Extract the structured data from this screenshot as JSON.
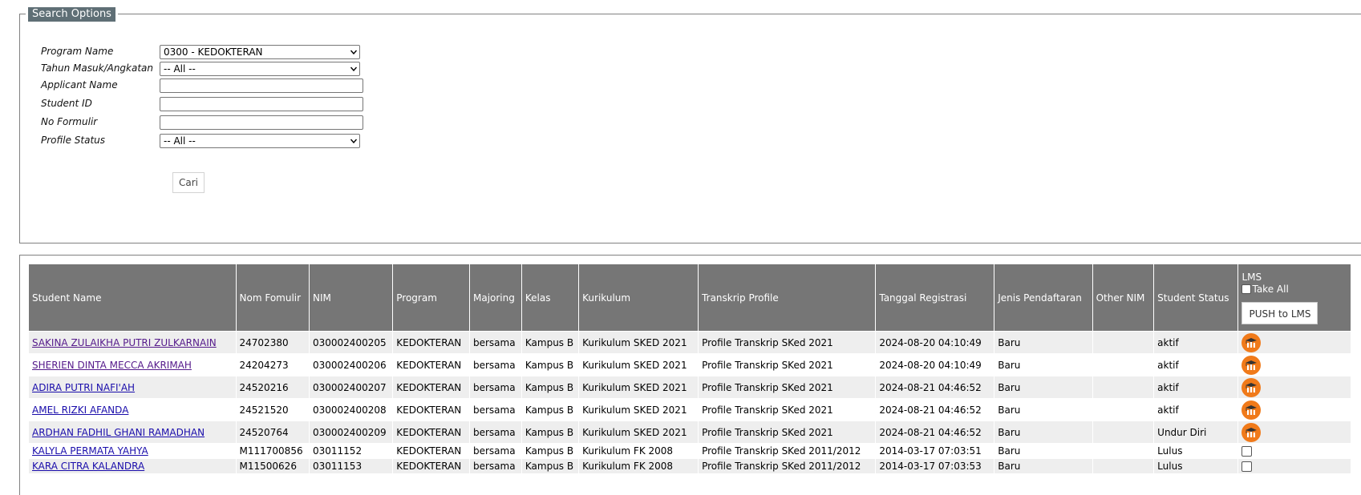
{
  "search": {
    "legend": "Search Options",
    "fields": [
      {
        "label": "Program Name",
        "type": "select",
        "value": "0300 - KEDOKTERAN"
      },
      {
        "label": "Tahun Masuk/Angkatan",
        "type": "select",
        "value": "-- All --"
      },
      {
        "label": "Applicant Name",
        "type": "text",
        "value": ""
      },
      {
        "label": "Student ID",
        "type": "text",
        "value": ""
      },
      {
        "label": "No Formulir",
        "type": "text",
        "value": ""
      },
      {
        "label": "Profile Status",
        "type": "select",
        "value": "-- All --"
      }
    ],
    "submit_label": "Cari"
  },
  "table": {
    "headers": [
      "Student Name",
      "Nom Fomulir",
      "NIM",
      "Program",
      "Majoring",
      "Kelas",
      "Kurikulum",
      "Transkrip Profile",
      "Tanggal Registrasi",
      "Jenis Pendaftaran",
      "Other NIM",
      "Student Status"
    ],
    "lms_header": {
      "label": "LMS",
      "take_all": "Take All",
      "push_button": "PUSH to LMS"
    },
    "rows": [
      {
        "name": "SAKINA ZULAIKHA PUTRI ZULKARNAIN",
        "formulir": "24702380",
        "nim": "030002400205",
        "program": "KEDOKTERAN",
        "majoring": "bersama",
        "kelas": "Kampus B",
        "kurikulum": "Kurikulum SKED 2021",
        "transkrip": "Profile Transkrip SKed 2021",
        "tanggal": "2024-08-20 04:10:49",
        "jenis": "Baru",
        "other_nim": "",
        "status": "aktif",
        "lms": "icon"
      },
      {
        "name": "SHERIEN DINTA MECCA AKRIMAH",
        "formulir": "24204273",
        "nim": "030002400206",
        "program": "KEDOKTERAN",
        "majoring": "bersama",
        "kelas": "Kampus B",
        "kurikulum": "Kurikulum SKED 2021",
        "transkrip": "Profile Transkrip SKed 2021",
        "tanggal": "2024-08-20 04:10:49",
        "jenis": "Baru",
        "other_nim": "",
        "status": "aktif",
        "lms": "icon"
      },
      {
        "name": "ADIRA PUTRI NAFI'AH",
        "formulir": "24520216",
        "nim": "030002400207",
        "program": "KEDOKTERAN",
        "majoring": "bersama",
        "kelas": "Kampus B",
        "kurikulum": "Kurikulum SKED 2021",
        "transkrip": "Profile Transkrip SKed 2021",
        "tanggal": "2024-08-21 04:46:52",
        "jenis": "Baru",
        "other_nim": "",
        "status": "aktif",
        "lms": "icon"
      },
      {
        "name": "AMEL RIZKI AFANDA",
        "formulir": "24521520",
        "nim": "030002400208",
        "program": "KEDOKTERAN",
        "majoring": "bersama",
        "kelas": "Kampus B",
        "kurikulum": "Kurikulum SKED 2021",
        "transkrip": "Profile Transkrip SKed 2021",
        "tanggal": "2024-08-21 04:46:52",
        "jenis": "Baru",
        "other_nim": "",
        "status": "aktif",
        "lms": "icon"
      },
      {
        "name": "ARDHAN FADHIL GHANI RAMADHAN",
        "formulir": "24520764",
        "nim": "030002400209",
        "program": "KEDOKTERAN",
        "majoring": "bersama",
        "kelas": "Kampus B",
        "kurikulum": "Kurikulum SKED 2021",
        "transkrip": "Profile Transkrip SKed 2021",
        "tanggal": "2024-08-21 04:46:52",
        "jenis": "Baru",
        "other_nim": "",
        "status": "Undur Diri",
        "lms": "icon"
      },
      {
        "name": "KALYLA PERMATA YAHYA",
        "formulir": "M111700856",
        "nim": "03011152",
        "program": "KEDOKTERAN",
        "majoring": "bersama",
        "kelas": "Kampus B",
        "kurikulum": "Kurikulum FK 2008",
        "transkrip": "Profile Transkrip SKed 2011/2012",
        "tanggal": "2014-03-17 07:03:51",
        "jenis": "Baru",
        "other_nim": "",
        "status": "Lulus",
        "lms": "checkbox"
      },
      {
        "name": "KARA CITRA KALANDRA",
        "formulir": "M11500626",
        "nim": "03011153",
        "program": "KEDOKTERAN",
        "majoring": "bersama",
        "kelas": "Kampus B",
        "kurikulum": "Kurikulum FK 2008",
        "transkrip": "Profile Transkrip SKed 2011/2012",
        "tanggal": "2014-03-17 07:03:53",
        "jenis": "Baru",
        "other_nim": "",
        "status": "Lulus",
        "lms": "checkbox"
      }
    ]
  },
  "colors": {
    "header_bg": "#767676",
    "legend_bg": "#5f6f76",
    "lms_icon": "#f07a1a",
    "link": "#1a0dab",
    "link_visited": "#551a8b"
  }
}
